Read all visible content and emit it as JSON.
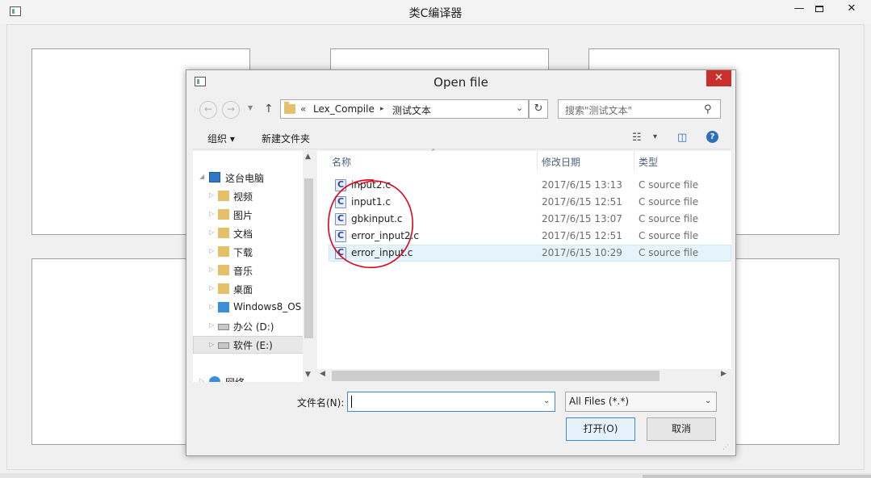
{
  "main_window": {
    "title": "类C编译器",
    "minimize": "—",
    "close": "✕"
  },
  "dialog": {
    "title": "Open file",
    "close": "✕",
    "nav": {
      "back": "←",
      "forward": "→",
      "recent": "▼",
      "up": "↑"
    },
    "address": {
      "chevron": "«",
      "crumbs": [
        "Lex_Compile",
        "测试文本"
      ],
      "separator": "▸",
      "dropdown": "⌄",
      "refresh": "↻"
    },
    "search": {
      "placeholder": "搜索\"测试文本\"",
      "icon": "⚲"
    },
    "toolbar": {
      "organize": "组织 ▾",
      "new_folder": "新建文件夹",
      "view_icon": "☷",
      "view_drop": "▾",
      "pane_icon": "◫",
      "help": "?"
    },
    "nav_pane": {
      "items": [
        {
          "label": "这台电脑",
          "icon": "computer-icon",
          "expand": "◢"
        },
        {
          "label": "视频",
          "icon": "videos-folder-icon",
          "expand": "▷"
        },
        {
          "label": "图片",
          "icon": "pictures-folder-icon",
          "expand": "▷"
        },
        {
          "label": "文档",
          "icon": "documents-folder-icon",
          "expand": "▷"
        },
        {
          "label": "下载",
          "icon": "downloads-folder-icon",
          "expand": "▷"
        },
        {
          "label": "音乐",
          "icon": "music-folder-icon",
          "expand": "▷"
        },
        {
          "label": "桌面",
          "icon": "desktop-folder-icon",
          "expand": "▷"
        },
        {
          "label": "Windows8_OS",
          "icon": "windows-drive-icon",
          "expand": "▷"
        },
        {
          "label": "办公 (D:)",
          "icon": "drive-icon",
          "expand": "▷"
        },
        {
          "label": "软件 (E:)",
          "icon": "drive-icon",
          "expand": "▷",
          "selected": true
        },
        {
          "label": "网络",
          "icon": "network-icon",
          "expand": "▷"
        }
      ],
      "scroll_up": "▲",
      "scroll_down": "▼"
    },
    "file_list": {
      "sort_indicator": "⌃",
      "columns": [
        "名称",
        "修改日期",
        "类型"
      ],
      "files": [
        {
          "name": "input2.c",
          "date": "2017/6/15 13:13",
          "type": "C source file"
        },
        {
          "name": "input1.c",
          "date": "2017/6/15 12:51",
          "type": "C source file"
        },
        {
          "name": "gbkinput.c",
          "date": "2017/6/15 13:07",
          "type": "C source file"
        },
        {
          "name": "error_input2.c",
          "date": "2017/6/15 12:51",
          "type": "C source file"
        },
        {
          "name": "error_input.c",
          "date": "2017/6/15 10:29",
          "type": "C source file",
          "selected": true
        }
      ],
      "scroll_left": "◀",
      "scroll_right": "▶"
    },
    "filename_label": "文件名(N):",
    "filename_value": "",
    "filename_drop": "⌄",
    "filetype_value": "All Files (*.*)",
    "filetype_drop": "⌄",
    "open_button": "打开(O)",
    "cancel_button": "取消",
    "grip": "⋰"
  },
  "colors": {
    "annotation": "#e0001a",
    "close_button": "#c9302c",
    "selection": "#e5f3fb"
  }
}
